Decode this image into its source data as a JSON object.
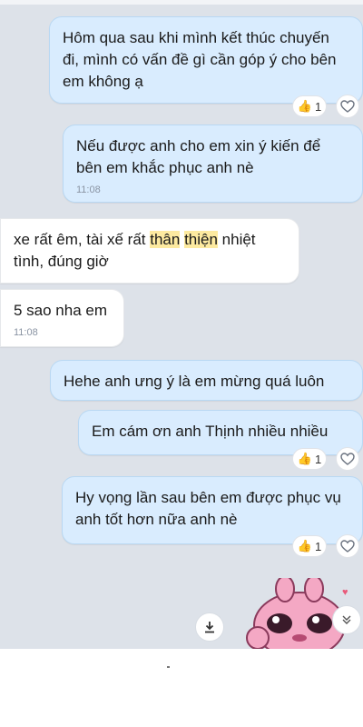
{
  "messages": [
    {
      "text": "Hôm qua sau khi mình kết thúc chuyến đi, mình có vấn đề gì cần góp ý cho bên em không ạ",
      "reaction_count": "1"
    },
    {
      "text": "Nếu được anh cho em xin ý kiến để bên em khắc phục anh nè",
      "time": "11:08"
    },
    {
      "text_before": "xe rất êm, tài xế rất ",
      "hl1": "thân",
      "space": " ",
      "hl2": "thiện",
      "text_after": " nhiệt tình, đúng giờ"
    },
    {
      "text": "5 sao nha em",
      "time": "11:08"
    },
    {
      "text": "Hehe anh ưng ý là em mừng quá luôn"
    },
    {
      "text": "Em cám ơn anh Thịnh nhiều nhiều",
      "reaction_count": "1"
    },
    {
      "text": "Hy vọng lần sau bên em được phục vụ anh tốt hơn nữa anh nè",
      "reaction_count": "1"
    }
  ],
  "icons": {
    "reaction": "thumbs-up-icon",
    "react_button": "heart-outline-icon",
    "download": "download-icon",
    "scroll_down": "double-chevron-down-icon",
    "sticker": "pink-cat-sticker"
  },
  "colors": {
    "outgoing_bubble": "#d9ecfe",
    "incoming_bubble": "#ffffff",
    "highlight": "#fdeaa0",
    "background": "#dde2e9"
  }
}
